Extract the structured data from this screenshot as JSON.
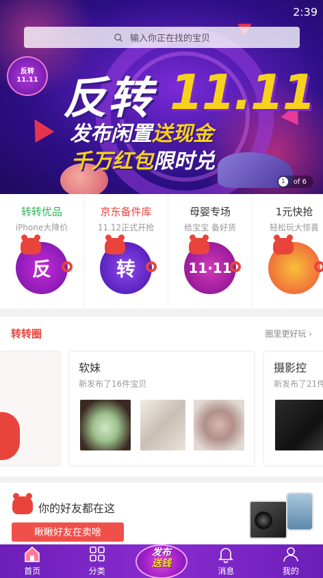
{
  "status_bar": {
    "time": "2:39"
  },
  "search": {
    "placeholder": "输入你正在找的宝贝"
  },
  "banner": {
    "badge_line1": "反转",
    "badge_line2": "11.11",
    "headline": "反转",
    "headline_num": "11.11",
    "subline1_a": "发布闲置",
    "subline1_b": "送现金",
    "subline2_a": "千万红包",
    "subline2_b": "限时兑",
    "pager_current": "1",
    "pager_total": "of 6"
  },
  "promos": [
    {
      "title": "转转优品",
      "subtitle": "iPhone大降价",
      "color": "#2fb35a",
      "art_text": "反",
      "art_color": "#b51fc4"
    },
    {
      "title": "京东备件库",
      "subtitle": "11.12正式开抢",
      "color": "#e8443c",
      "art_text": "转",
      "art_color": "#7a3be0"
    },
    {
      "title": "母婴专场",
      "subtitle": "给宝宝 备好货",
      "color": "#333333",
      "art_text": "11·11",
      "art_color": "#c21fb0"
    },
    {
      "title": "1元快抢",
      "subtitle": "轻松玩大惊喜",
      "color": "#333333",
      "art_text": "",
      "art_color": "#f07a3a"
    }
  ],
  "circle": {
    "title": "转转圈",
    "more": "圈里更好玩",
    "cards": [
      {
        "name": "软妹",
        "desc": "新发布了16件宝贝"
      },
      {
        "name": "摄影控",
        "desc": "新发布了21件"
      }
    ]
  },
  "friends": {
    "title": "你的好友都在这",
    "button": "瞅瞅好友在卖啥"
  },
  "nav": {
    "home": "首页",
    "category": "分类",
    "publish_a": "发布",
    "publish_b": "送钱",
    "messages": "消息",
    "me": "我的"
  },
  "colors": {
    "accent_red": "#e8443c",
    "nav_purple": "#7a25c4",
    "green": "#2fb35a"
  }
}
